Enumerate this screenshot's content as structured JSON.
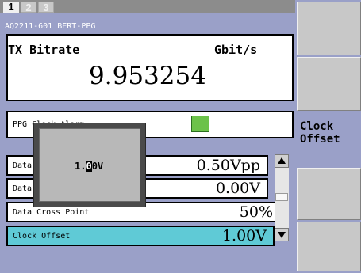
{
  "tabs": [
    {
      "label": "1",
      "active": true
    },
    {
      "label": "2",
      "active": false
    },
    {
      "label": "3",
      "active": false
    }
  ],
  "module_name": "AQ2211-601 BERT-PPG",
  "tx_bitrate": {
    "label": "TX Bitrate",
    "unit": "Gbit/s",
    "value": "9.953254"
  },
  "ppg_clock_alarm": {
    "label": "PPG Clock Alarm",
    "status_color": "#6cc24a"
  },
  "parameters": [
    {
      "label": "Data",
      "value": "0.50Vpp",
      "selected": false
    },
    {
      "label": "Data",
      "value": "0.00V",
      "selected": false
    },
    {
      "label": "Data Cross Point",
      "value": "50%",
      "selected": false
    },
    {
      "label": "Clock Offset",
      "value": "1.00V",
      "selected": true
    }
  ],
  "popup": {
    "value_before": "1.",
    "value_cursor": "0",
    "value_after": "0V"
  },
  "softkeys": [
    {
      "label": ""
    },
    {
      "label": ""
    },
    {
      "label": "Clock\nOffset"
    },
    {
      "label": ""
    },
    {
      "label": ""
    }
  ],
  "colors": {
    "background": "#9aa0c8",
    "selected_row": "#5fcad6",
    "alarm_ok": "#6cc24a"
  }
}
